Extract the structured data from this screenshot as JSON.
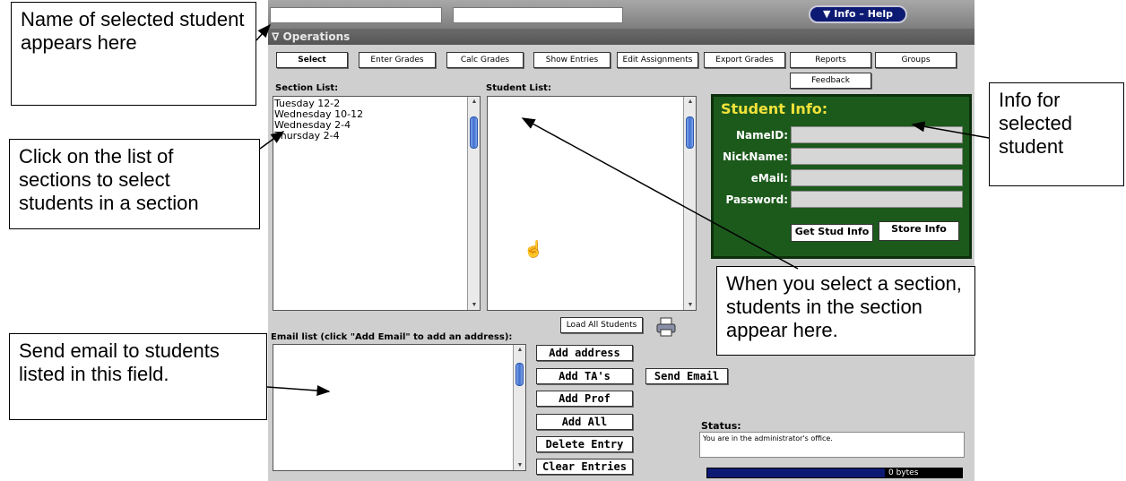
{
  "annotations": {
    "name_selected": "Name of selected student appears here",
    "click_sections": "Click on the list of sections to select students in a section",
    "send_email": "Send email to students listed in this field.",
    "info_selected": "Info for selected student",
    "when_select": "When you select a section, students in the section appear here."
  },
  "app": {
    "help_label": "▼ Info – Help",
    "operations_label": "∇ Operations",
    "toolbar": {
      "select": "Select",
      "enter_grades": "Enter Grades",
      "calc_grades": "Calc Grades",
      "show_entries": "Show Entries",
      "edit_assignments": "Edit Assignments",
      "export_grades": "Export Grades",
      "reports": "Reports",
      "groups": "Groups",
      "feedback": "Feedback"
    },
    "section_list": {
      "label": "Section List:",
      "items": [
        "Tuesday 12-2",
        "Wednesday 10-12",
        "Wednesday 2-4",
        "Thursday 2-4"
      ]
    },
    "student_list": {
      "label": "Student List:"
    },
    "student_info": {
      "title": "Student Info:",
      "nameid_label": "NameID:",
      "nickname_label": "NickName:",
      "email_label": "eMail:",
      "password_label": "Password:",
      "get_button": "Get Stud Info",
      "store_button": "Store Info"
    },
    "load_all": "Load All Students",
    "email": {
      "label": "Email list (click \"Add Email\" to add an address):",
      "add_address": "Add address",
      "add_tas": "Add TA's",
      "add_prof": "Add Prof",
      "add_all": "Add All",
      "delete_entry": "Delete Entry",
      "clear_entries": "Clear Entries",
      "send_email": "Send Email"
    },
    "status": {
      "label": "Status:",
      "text": "You are in the administrator's office.",
      "bytes": "0 bytes"
    }
  },
  "colors": {
    "info_panel_bg": "#1c5a1c",
    "info_title": "#f2e23a",
    "help_button_bg": "#0c1a73",
    "progress_bg": "#0c1a73"
  }
}
